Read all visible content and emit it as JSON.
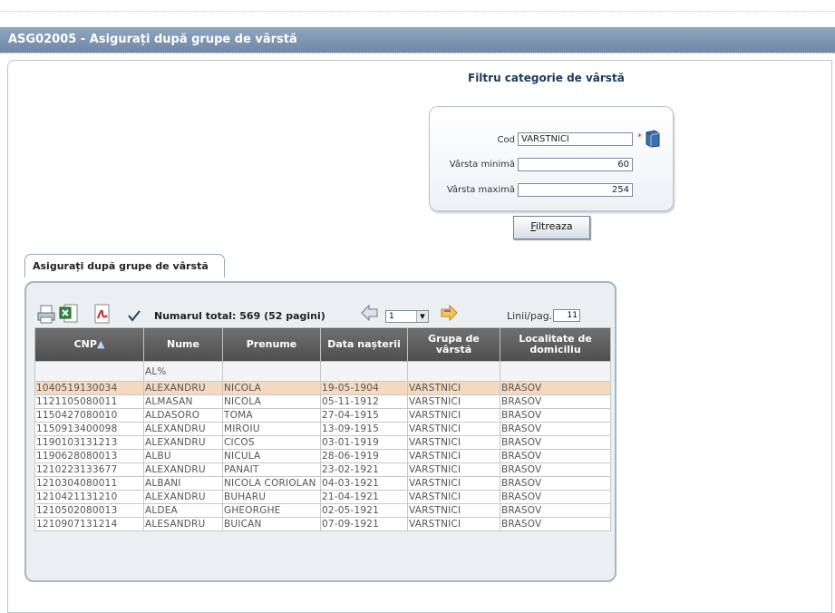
{
  "window": {
    "title": "ASG02005 - Asigurați după grupe de vârstă"
  },
  "filter": {
    "title": "Filtru categorie de vârstă",
    "cod_label": "Cod",
    "cod_value": "VARSTNICI",
    "required_mark": "*",
    "min_label": "Vârsta minimă",
    "min_value": "60",
    "max_label": "Vârsta maximă",
    "max_value": "254",
    "button_label_first": "F",
    "button_label_rest": "iltreaza"
  },
  "tab": {
    "label": "Asigurați după grupe de vârstă"
  },
  "toolbar": {
    "icons": [
      "printer-icon",
      "excel-icon",
      "pdf-icon",
      "checkmark-icon"
    ],
    "total_text": "Numarul total: 569 (52 pagini)",
    "page_value": "1",
    "lines_label": "Linii/pag.",
    "lines_value": "11"
  },
  "table": {
    "headers": [
      "CNP",
      "Nume",
      "Prenume",
      "Data nașterii",
      "Grupa de vârstă",
      "Localitate de domiciliu"
    ],
    "sort_indicator": "▲",
    "filters": [
      "",
      "AL%",
      "",
      "",
      "",
      ""
    ],
    "rows": [
      [
        "1040519130034",
        "ALEXANDRU",
        "NICOLA",
        "19-05-1904",
        "VARSTNICI",
        "BRASOV"
      ],
      [
        "1121105080011",
        "ALMASAN",
        "NICOLA",
        "05-11-1912",
        "VARSTNICI",
        "BRASOV"
      ],
      [
        "1150427080010",
        "ALDASORO",
        "TOMA",
        "27-04-1915",
        "VARSTNICI",
        "BRASOV"
      ],
      [
        "1150913400098",
        "ALEXANDRU",
        "MIROIU",
        "13-09-1915",
        "VARSTNICI",
        "BRASOV"
      ],
      [
        "1190103131213",
        "ALEXANDRU",
        "CICOS",
        "03-01-1919",
        "VARSTNICI",
        "BRASOV"
      ],
      [
        "1190628080013",
        "ALBU",
        "NICULA",
        "28-06-1919",
        "VARSTNICI",
        "BRASOV"
      ],
      [
        "1210223133677",
        "ALEXANDRU",
        "PANAIT",
        "23-02-1921",
        "VARSTNICI",
        "BRASOV"
      ],
      [
        "1210304080011",
        "ALBANI",
        "NICOLA CORIOLAN",
        "04-03-1921",
        "VARSTNICI",
        "BRASOV"
      ],
      [
        "1210421131210",
        "ALEXANDRU",
        "BUHARU",
        "21-04-1921",
        "VARSTNICI",
        "BRASOV"
      ],
      [
        "1210502080013",
        "ALDEA",
        "GHEORGHE",
        "02-05-1921",
        "VARSTNICI",
        "BRASOV"
      ],
      [
        "1210907131214",
        "ALESANDRU",
        "BUICAN",
        "07-09-1921",
        "VARSTNICI",
        "BRASOV"
      ]
    ]
  }
}
